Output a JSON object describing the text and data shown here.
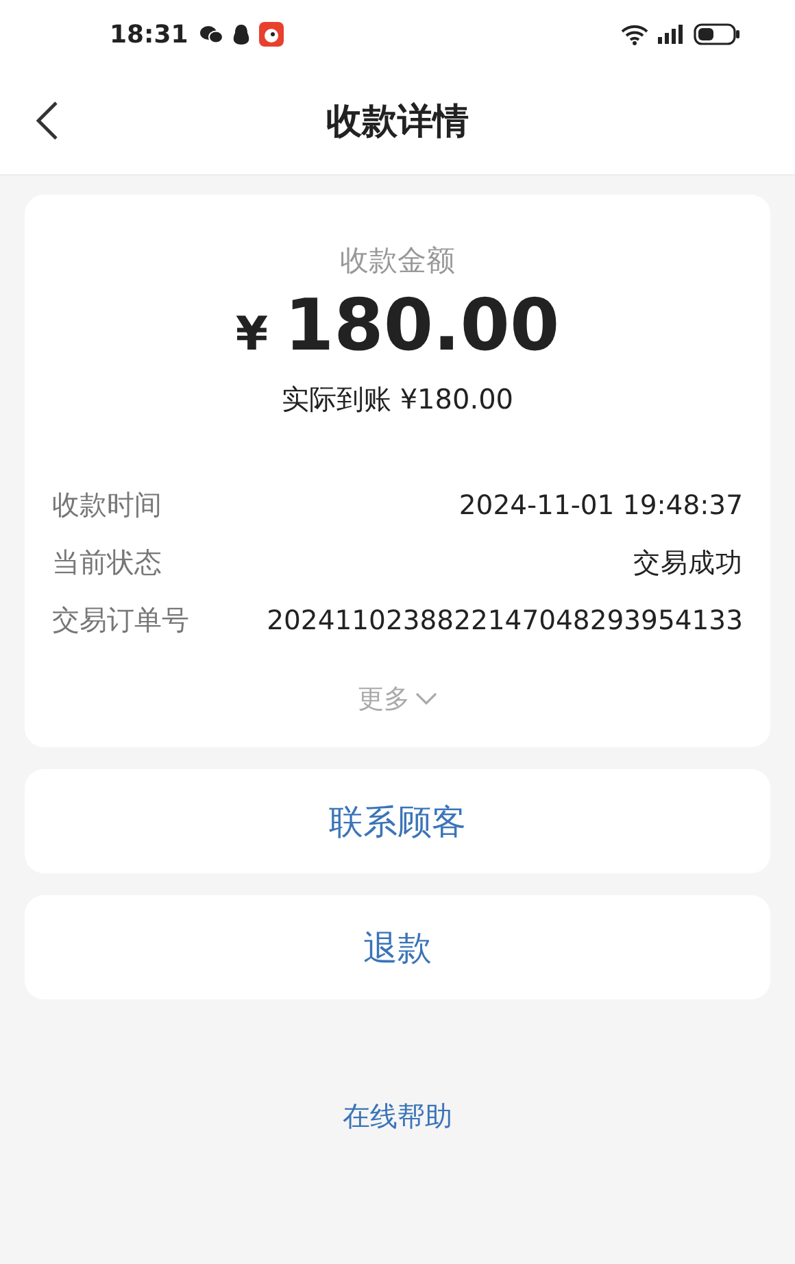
{
  "status_bar": {
    "time": "18:31"
  },
  "header": {
    "title": "收款详情"
  },
  "summary": {
    "label": "收款金额",
    "currency": "¥",
    "amount": "180.00",
    "received": "实际到账 ¥180.00"
  },
  "details": [
    {
      "label": "收款时间",
      "value": "2024-11-01 19:48:37"
    },
    {
      "label": "当前状态",
      "value": "交易成功"
    },
    {
      "label": "交易订单号",
      "value": "2024110238822147048293954133"
    }
  ],
  "more": "更多",
  "actions": [
    "联系顾客",
    "退款"
  ],
  "help_link": "在线帮助"
}
